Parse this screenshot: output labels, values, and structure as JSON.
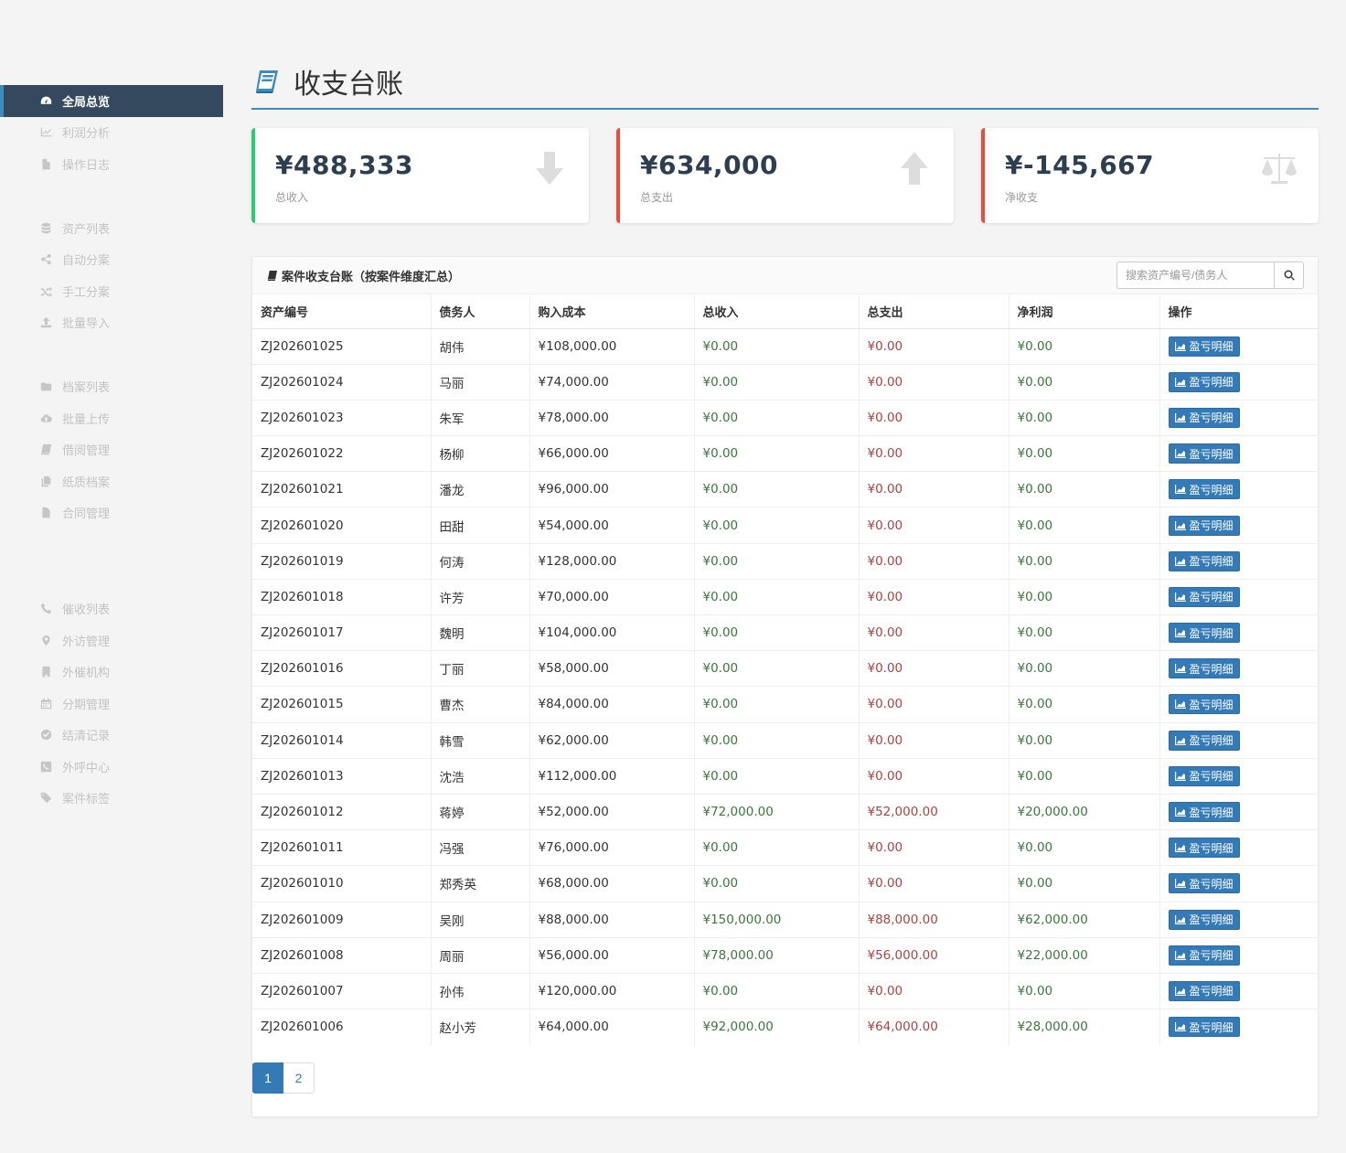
{
  "sidebar": {
    "groups": [
      [
        {
          "label": "全局总览",
          "icon": "dashboard-icon",
          "active": true
        },
        {
          "label": "利润分析",
          "icon": "line-chart-icon"
        },
        {
          "label": "操作日志",
          "icon": "file-icon"
        }
      ],
      [
        {
          "label": "资产列表",
          "icon": "database-icon"
        },
        {
          "label": "自动分案",
          "icon": "share-icon"
        },
        {
          "label": "手工分案",
          "icon": "random-icon"
        },
        {
          "label": "批量导入",
          "icon": "upload-icon"
        }
      ],
      [
        {
          "label": "档案列表",
          "icon": "folder-icon"
        },
        {
          "label": "批量上传",
          "icon": "cloud-upload-icon"
        },
        {
          "label": "借阅管理",
          "icon": "book-icon"
        },
        {
          "label": "纸质档案",
          "icon": "copy-icon"
        },
        {
          "label": "合同管理",
          "icon": "file-text-icon"
        }
      ],
      [
        {
          "label": "催收列表",
          "icon": "phone-icon"
        },
        {
          "label": "外访管理",
          "icon": "map-marker-icon"
        },
        {
          "label": "外催机构",
          "icon": "building-icon"
        },
        {
          "label": "分期管理",
          "icon": "calendar-icon"
        },
        {
          "label": "结清记录",
          "icon": "check-circle-icon"
        },
        {
          "label": "外呼中心",
          "icon": "phone-square-icon"
        },
        {
          "label": "案件标签",
          "icon": "tags-icon"
        }
      ]
    ]
  },
  "header": {
    "title": "收支台账",
    "icon": "book-icon"
  },
  "summary": [
    {
      "value": "¥488,333",
      "label": "总收入",
      "icon": "arrow-down-icon",
      "accent": "#2ecc71"
    },
    {
      "value": "¥634,000",
      "label": "总支出",
      "icon": "arrow-up-icon",
      "accent": "#e74c3c"
    },
    {
      "value": "¥-145,667",
      "label": "净收支",
      "icon": "balance-scale-icon",
      "accent": "#e74c3c"
    }
  ],
  "panel": {
    "title": "案件收支台账（按案件维度汇总）",
    "search_placeholder": "搜索资产编号/债务人",
    "columns": [
      "资产编号",
      "债务人",
      "购入成本",
      "总收入",
      "总支出",
      "净利润",
      "操作"
    ],
    "action_label": "盈亏明细",
    "rows": [
      [
        "ZJ202601025",
        "胡伟",
        "¥108,000.00",
        "¥0.00",
        "¥0.00",
        "¥0.00"
      ],
      [
        "ZJ202601024",
        "马丽",
        "¥74,000.00",
        "¥0.00",
        "¥0.00",
        "¥0.00"
      ],
      [
        "ZJ202601023",
        "朱军",
        "¥78,000.00",
        "¥0.00",
        "¥0.00",
        "¥0.00"
      ],
      [
        "ZJ202601022",
        "杨柳",
        "¥66,000.00",
        "¥0.00",
        "¥0.00",
        "¥0.00"
      ],
      [
        "ZJ202601021",
        "潘龙",
        "¥96,000.00",
        "¥0.00",
        "¥0.00",
        "¥0.00"
      ],
      [
        "ZJ202601020",
        "田甜",
        "¥54,000.00",
        "¥0.00",
        "¥0.00",
        "¥0.00"
      ],
      [
        "ZJ202601019",
        "何涛",
        "¥128,000.00",
        "¥0.00",
        "¥0.00",
        "¥0.00"
      ],
      [
        "ZJ202601018",
        "许芳",
        "¥70,000.00",
        "¥0.00",
        "¥0.00",
        "¥0.00"
      ],
      [
        "ZJ202601017",
        "魏明",
        "¥104,000.00",
        "¥0.00",
        "¥0.00",
        "¥0.00"
      ],
      [
        "ZJ202601016",
        "丁丽",
        "¥58,000.00",
        "¥0.00",
        "¥0.00",
        "¥0.00"
      ],
      [
        "ZJ202601015",
        "曹杰",
        "¥84,000.00",
        "¥0.00",
        "¥0.00",
        "¥0.00"
      ],
      [
        "ZJ202601014",
        "韩雪",
        "¥62,000.00",
        "¥0.00",
        "¥0.00",
        "¥0.00"
      ],
      [
        "ZJ202601013",
        "沈浩",
        "¥112,000.00",
        "¥0.00",
        "¥0.00",
        "¥0.00"
      ],
      [
        "ZJ202601012",
        "蒋婷",
        "¥52,000.00",
        "¥72,000.00",
        "¥52,000.00",
        "¥20,000.00"
      ],
      [
        "ZJ202601011",
        "冯强",
        "¥76,000.00",
        "¥0.00",
        "¥0.00",
        "¥0.00"
      ],
      [
        "ZJ202601010",
        "郑秀英",
        "¥68,000.00",
        "¥0.00",
        "¥0.00",
        "¥0.00"
      ],
      [
        "ZJ202601009",
        "吴刚",
        "¥88,000.00",
        "¥150,000.00",
        "¥88,000.00",
        "¥62,000.00"
      ],
      [
        "ZJ202601008",
        "周丽",
        "¥56,000.00",
        "¥78,000.00",
        "¥56,000.00",
        "¥22,000.00"
      ],
      [
        "ZJ202601007",
        "孙伟",
        "¥120,000.00",
        "¥0.00",
        "¥0.00",
        "¥0.00"
      ],
      [
        "ZJ202601006",
        "赵小芳",
        "¥64,000.00",
        "¥92,000.00",
        "¥64,000.00",
        "¥28,000.00"
      ]
    ]
  },
  "pagination": {
    "pages": [
      "1",
      "2"
    ],
    "current": "1"
  }
}
